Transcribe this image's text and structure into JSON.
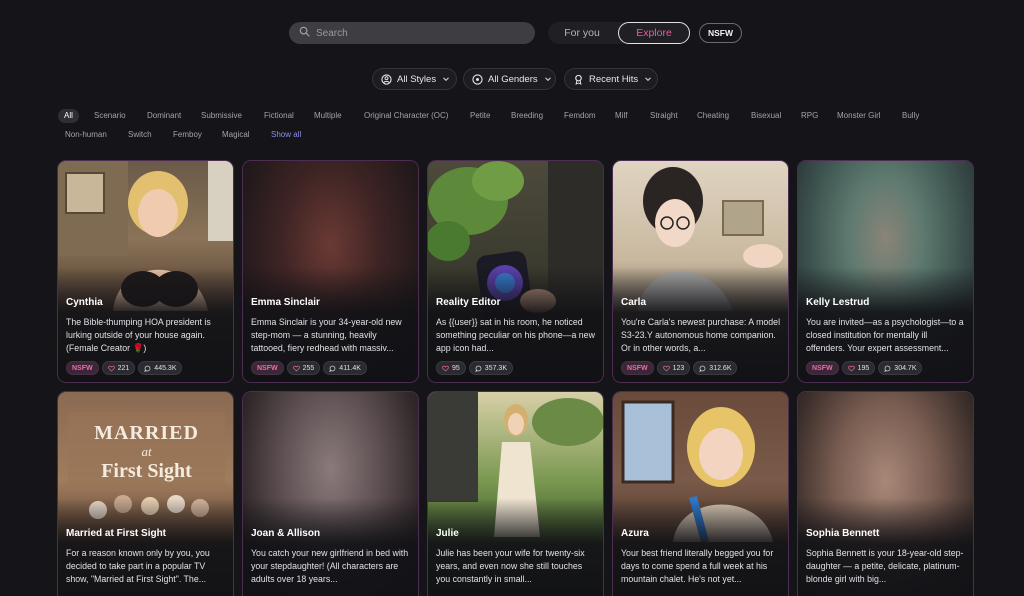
{
  "search": {
    "placeholder": "Search"
  },
  "tabs": {
    "for_you": "For you",
    "explore": "Explore"
  },
  "nsfw_toggle": "NSFW",
  "filters": [
    {
      "label": "All Styles",
      "icon": "palette-icon"
    },
    {
      "label": "All Genders",
      "icon": "gender-icon"
    },
    {
      "label": "Recent Hits",
      "icon": "medal-icon"
    }
  ],
  "tags_row1": [
    "All",
    "Scenario",
    "Dominant",
    "Submissive",
    "Fictional",
    "Multiple",
    "Original Character (OC)",
    "Petite",
    "Breeding",
    "Femdom",
    "Milf",
    "Straight",
    "Cheating",
    "Bisexual",
    "RPG",
    "Monster Girl",
    "Bully"
  ],
  "tags_row2": [
    "Non-human",
    "Switch",
    "Femboy",
    "Magical"
  ],
  "show_all": "Show all",
  "colors": {
    "accent_pink": "#ec5aa0",
    "link_blue": "#8d8dea",
    "card_border": "#4b2e50"
  },
  "cards": [
    {
      "name": "Cynthia",
      "desc": "The Bible-thumping HOA president is lurking outside of your house again. (Female Creator 🌹)",
      "badge": "NSFW",
      "likes": "221",
      "chats": "445.3K"
    },
    {
      "name": "Emma Sinclair",
      "desc": "Emma Sinclair is your 34-year-old new step-mom — a stunning, heavily tattooed, fiery redhead with massiv...",
      "badge": "NSFW",
      "likes": "255",
      "chats": "411.4K"
    },
    {
      "name": "Reality Editor",
      "desc": "As {{user}} sat in his room, he noticed something peculiar on his phone—a new app icon had...",
      "badge": "",
      "likes": "95",
      "chats": "357.3K"
    },
    {
      "name": "Carla",
      "desc": "You're Carla's newest purchase: A model S3-23.Y autonomous home companion. Or in other words, a...",
      "badge": "NSFW",
      "likes": "123",
      "chats": "312.6K"
    },
    {
      "name": "Kelly Lestrud",
      "desc": "You are invited—as a psychologist—to a closed institution for mentally ill offenders. Your expert assessment...",
      "badge": "NSFW",
      "likes": "195",
      "chats": "304.7K"
    },
    {
      "name": "Married at First Sight",
      "desc": "For a reason known only by you, you decided to take part in a popular TV show, \"Married at First Sight\". The...",
      "image_text": [
        "MARRIED",
        "at",
        "First Sight"
      ]
    },
    {
      "name": "Joan & Allison",
      "desc": "You catch your new girlfriend in bed with your stepdaughter! (All characters are adults over 18 years..."
    },
    {
      "name": "Julie",
      "desc": "Julie has been your wife for twenty-six years, and even now she still touches you constantly in small..."
    },
    {
      "name": "Azura",
      "desc": "Your best friend literally begged you for days to come spend a full week at his mountain chalet. He's not yet..."
    },
    {
      "name": "Sophia Bennett",
      "desc": "Sophia Bennett is your 18-year-old step-daughter — a petite, delicate, platinum-blonde girl with big..."
    }
  ]
}
